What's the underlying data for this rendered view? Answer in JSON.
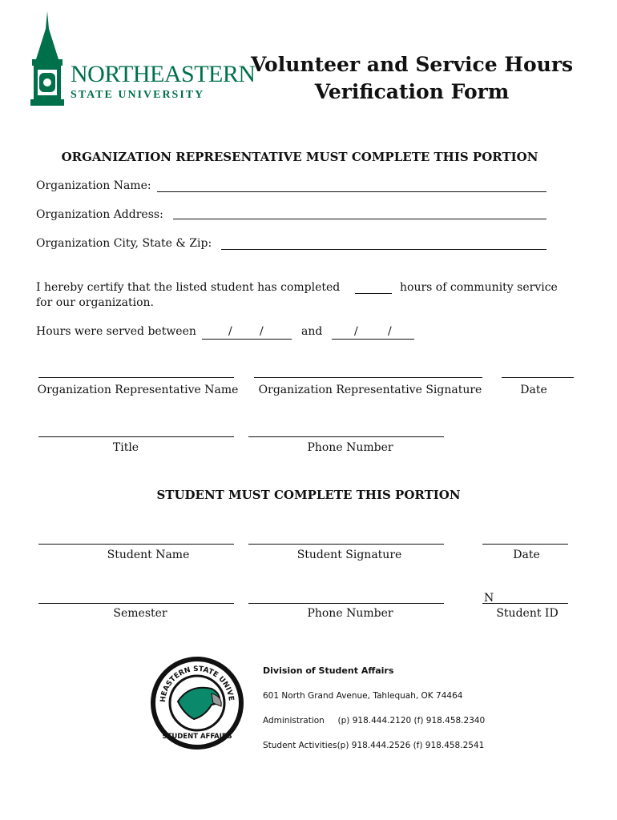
{
  "logo": {
    "name": "NORTHEASTERN",
    "sub": "STATE UNIVERSITY",
    "color": "#00704a"
  },
  "title": {
    "line1": "Volunteer and Service Hours",
    "line2": "Verification Form"
  },
  "org_section": {
    "heading": "ORGANIZATION REPRESENTATIVE MUST COMPLETE THIS PORTION",
    "name_label": "Organization Name:",
    "address_label": "Organization Address:",
    "city_label": "Organization City, State & Zip:",
    "certify_1": "I hereby certify that the listed student has completed",
    "certify_2": "hours of community service",
    "certify_3": "for our organization.",
    "hours_label": "Hours were served between",
    "slash": "/",
    "and": "and",
    "rep_name": "Organization Representative Name",
    "rep_signature": "Organization Representative Signature",
    "date": "Date",
    "title_label": "Title",
    "phone": "Phone Number"
  },
  "student_section": {
    "heading": "STUDENT MUST COMPLETE THIS PORTION",
    "name": "Student Name",
    "signature": "Student Signature",
    "date": "Date",
    "semester": "Semester",
    "phone": "Phone Number",
    "id_prefix": "N",
    "student_id": "Student ID"
  },
  "footer": {
    "seal_top": "NORTHEASTERN STATE UNIVERSITY",
    "seal_bottom": "STUDENT AFFAIRS",
    "division": "Division of Student Affairs",
    "address": "601 North Grand Avenue, Tahlequah, OK 74464",
    "admin": "Administration     (p) 918.444.2120 (f) 918.458.2340",
    "activities": "Student Activities(p) 918.444.2526 (f) 918.458.2541"
  }
}
